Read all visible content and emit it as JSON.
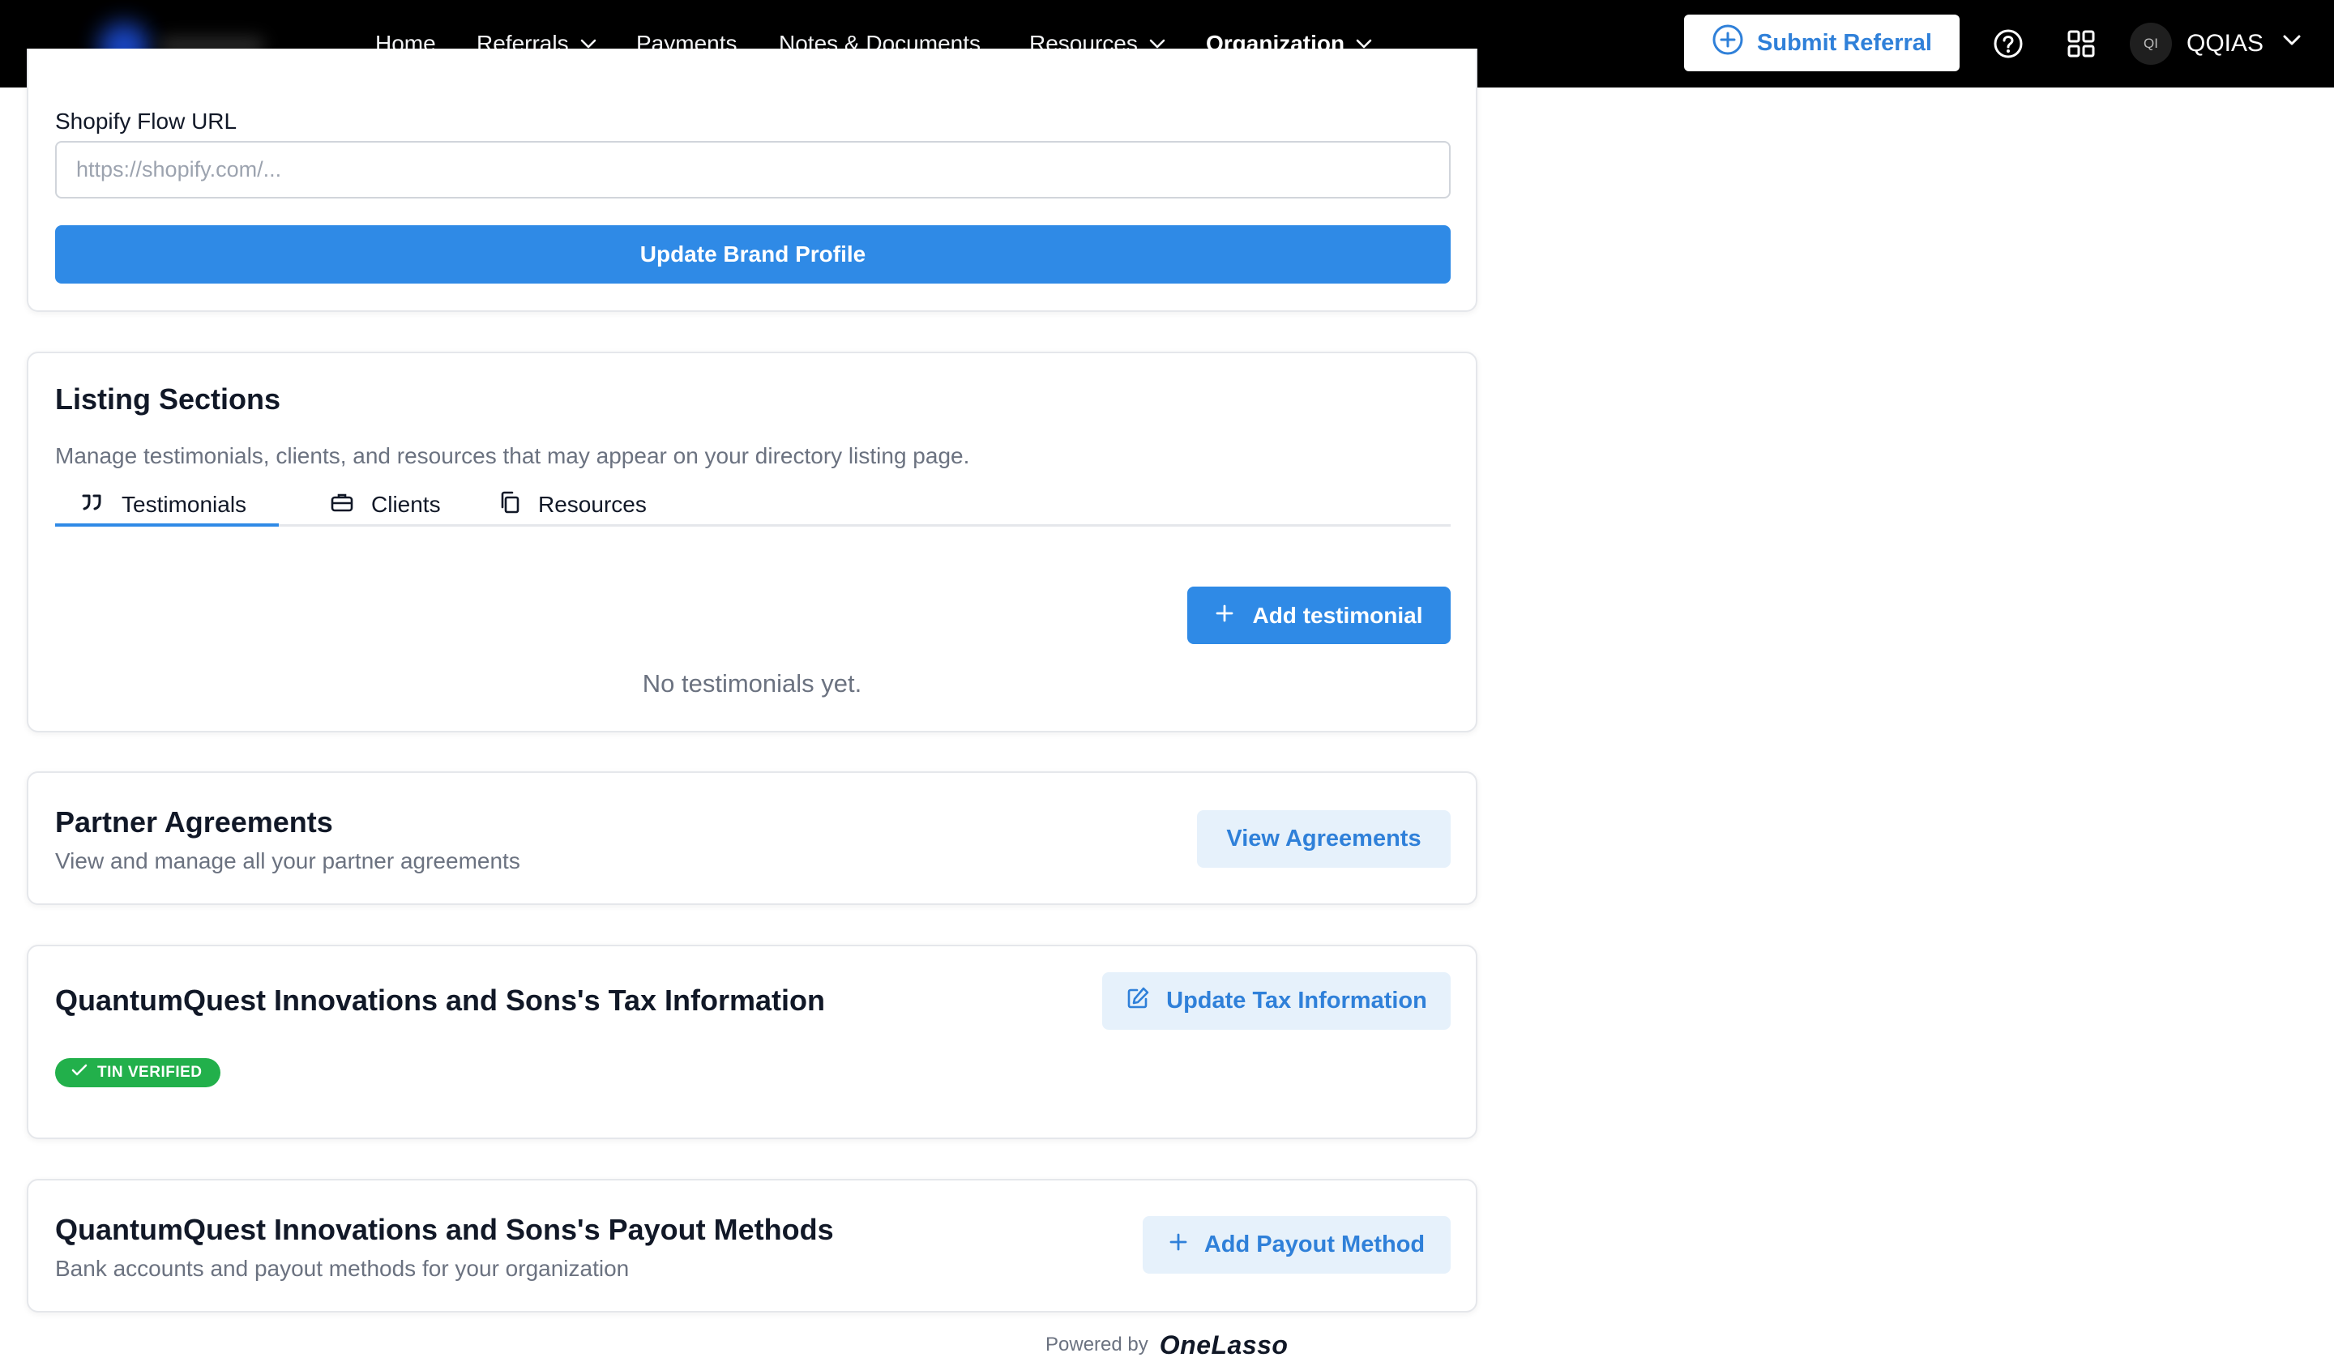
{
  "nav": {
    "items": [
      {
        "label": "Home",
        "has_dropdown": false
      },
      {
        "label": "Referrals",
        "has_dropdown": true
      },
      {
        "label": "Payments",
        "has_dropdown": false
      },
      {
        "label": "Notes & Documents",
        "has_dropdown": false
      },
      {
        "label": "Resources",
        "has_dropdown": true
      },
      {
        "label": "Organization",
        "has_dropdown": true,
        "active": true
      }
    ],
    "submit_label": "Submit Referral",
    "user_initials": "QI",
    "user_name": "QQIAS",
    "accent_color": "#2f80d9"
  },
  "brand_profile": {
    "shopify_label": "Shopify Flow URL",
    "shopify_value": "",
    "shopify_placeholder": "https://shopify.com/...",
    "update_button": "Update Brand Profile"
  },
  "listing": {
    "title": "Listing Sections",
    "description": "Manage testimonials, clients, and resources that may appear on your directory listing page.",
    "tabs": [
      {
        "label": "Testimonials",
        "icon": "quote-icon",
        "active": true
      },
      {
        "label": "Clients",
        "icon": "briefcase-icon",
        "active": false
      },
      {
        "label": "Resources",
        "icon": "copy-icon",
        "active": false
      }
    ],
    "add_button": "Add testimonial",
    "empty_message": "No testimonials yet."
  },
  "agreements": {
    "title": "Partner Agreements",
    "description": "View and manage all your partner agreements",
    "button": "View Agreements"
  },
  "tax": {
    "title": "QuantumQuest Innovations and Sons's Tax Information",
    "button": "Update Tax Information",
    "badge": "TIN VERIFIED",
    "badge_color": "#22b04b"
  },
  "payout": {
    "title": "QuantumQuest Innovations and Sons's Payout Methods",
    "description": "Bank accounts and payout methods for your organization",
    "button": "Add Payout Method"
  },
  "footer": {
    "powered_by": "Powered by",
    "brand": "OneLasso"
  }
}
